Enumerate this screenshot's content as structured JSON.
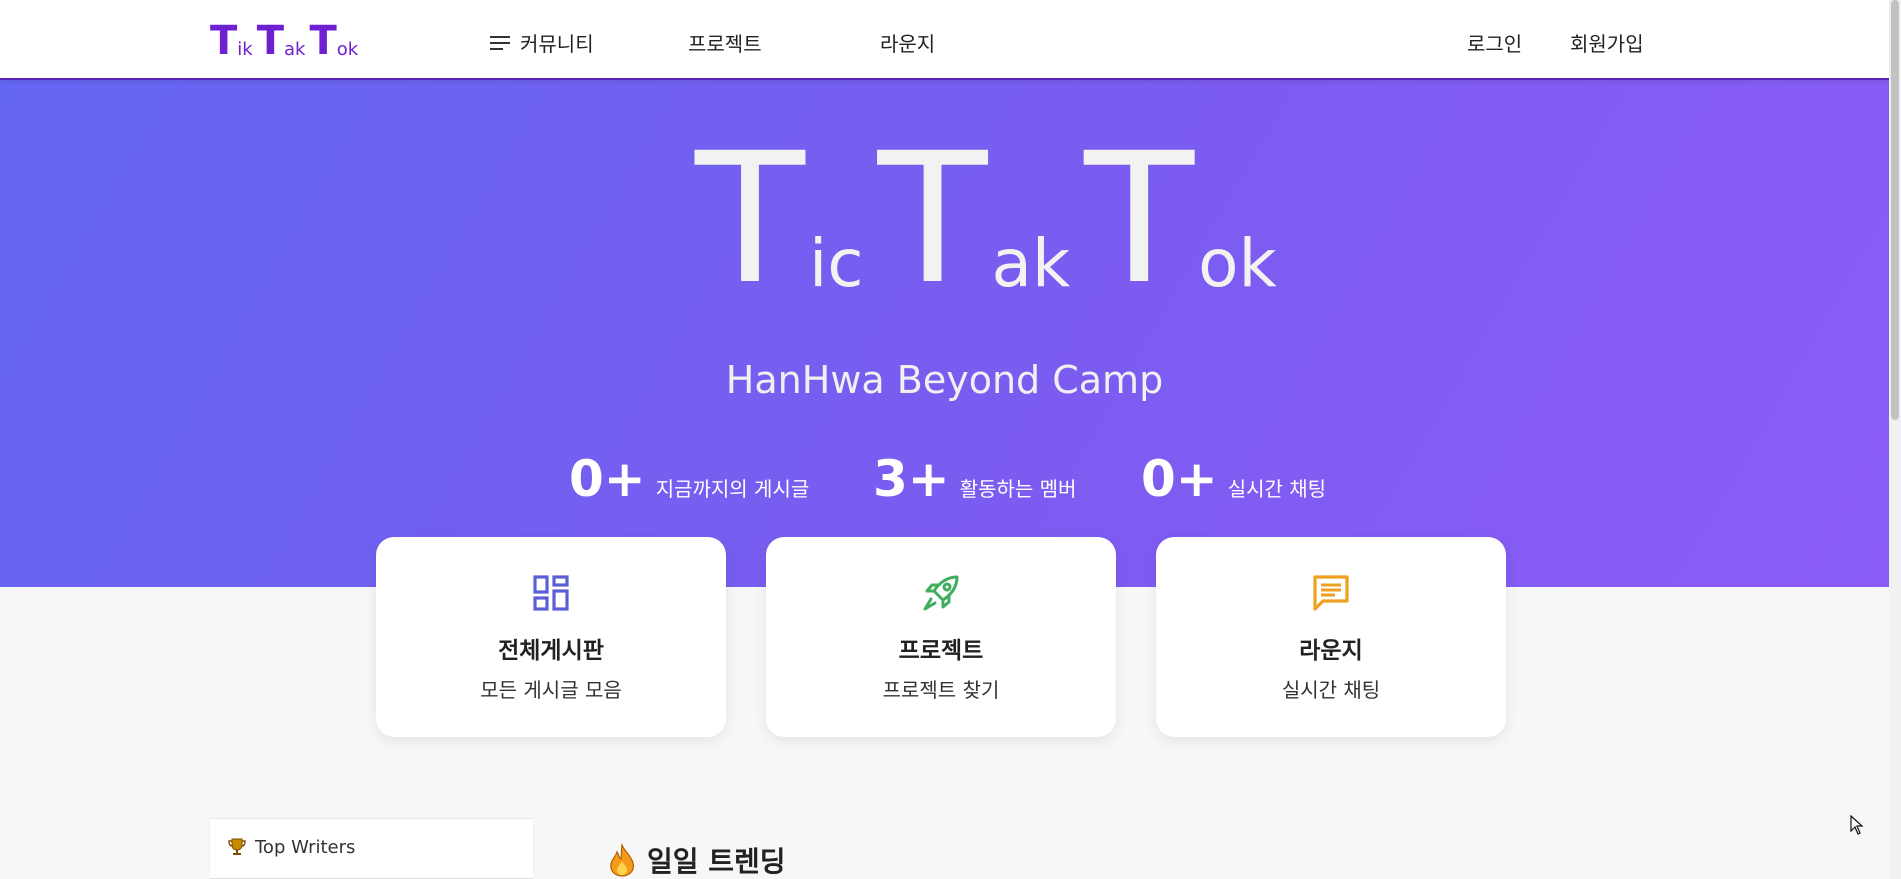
{
  "nav": {
    "logo": [
      "T",
      "ik",
      "T",
      "ak",
      "T",
      "ok"
    ],
    "community": "커뮤니티",
    "project": "프로젝트",
    "lounge": "라운지",
    "login": "로그인",
    "signup": "회원가입"
  },
  "hero": {
    "title": [
      "T",
      "ic",
      "T",
      "ak",
      "T",
      "ok"
    ],
    "subtitle": "HanHwa Beyond Camp",
    "stats": [
      {
        "num": "0+",
        "label": "지금까지의 게시글"
      },
      {
        "num": "3+",
        "label": "활동하는 멤버"
      },
      {
        "num": "0+",
        "label": "실시간 채팅"
      }
    ]
  },
  "cards": [
    {
      "title": "전체게시판",
      "desc": "모든 게시글 모음",
      "icon": "dashboard-icon",
      "color": "#5b5fd6"
    },
    {
      "title": "프로젝트",
      "desc": "프로젝트 찾기",
      "icon": "rocket-icon",
      "color": "#3fae5e"
    },
    {
      "title": "라운지",
      "desc": "실시간 채팅",
      "icon": "chat-icon",
      "color": "#f0a020"
    }
  ],
  "bottom": {
    "top_writers": "Top Writers",
    "trending": "일일 트렌딩"
  },
  "colors": {
    "brand": "#6d1fd1",
    "hero_start": "#6366f1",
    "hero_end": "#8b5cf6"
  }
}
